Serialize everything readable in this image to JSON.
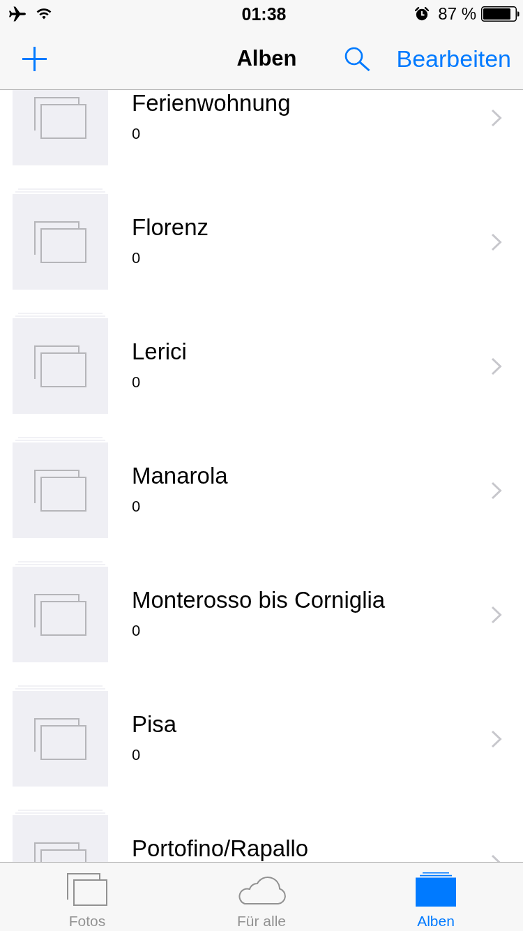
{
  "status_bar": {
    "time": "01:38",
    "battery": "87 %"
  },
  "nav_bar": {
    "title": "Alben",
    "edit_button": "Bearbeiten"
  },
  "albums": [
    {
      "title": "Ferienwohnung",
      "count": "0"
    },
    {
      "title": "Florenz",
      "count": "0"
    },
    {
      "title": "Lerici",
      "count": "0"
    },
    {
      "title": "Manarola",
      "count": "0"
    },
    {
      "title": "Monterosso bis Corniglia",
      "count": "0"
    },
    {
      "title": "Pisa",
      "count": "0"
    },
    {
      "title": "Portofino/Rapallo"
    }
  ],
  "tab_bar": {
    "tabs": [
      {
        "kind": "photos",
        "label": "Fotos",
        "selected": false
      },
      {
        "kind": "shared",
        "label": "Für alle",
        "selected": false
      },
      {
        "kind": "albums",
        "label": "Alben",
        "selected": true
      }
    ]
  }
}
